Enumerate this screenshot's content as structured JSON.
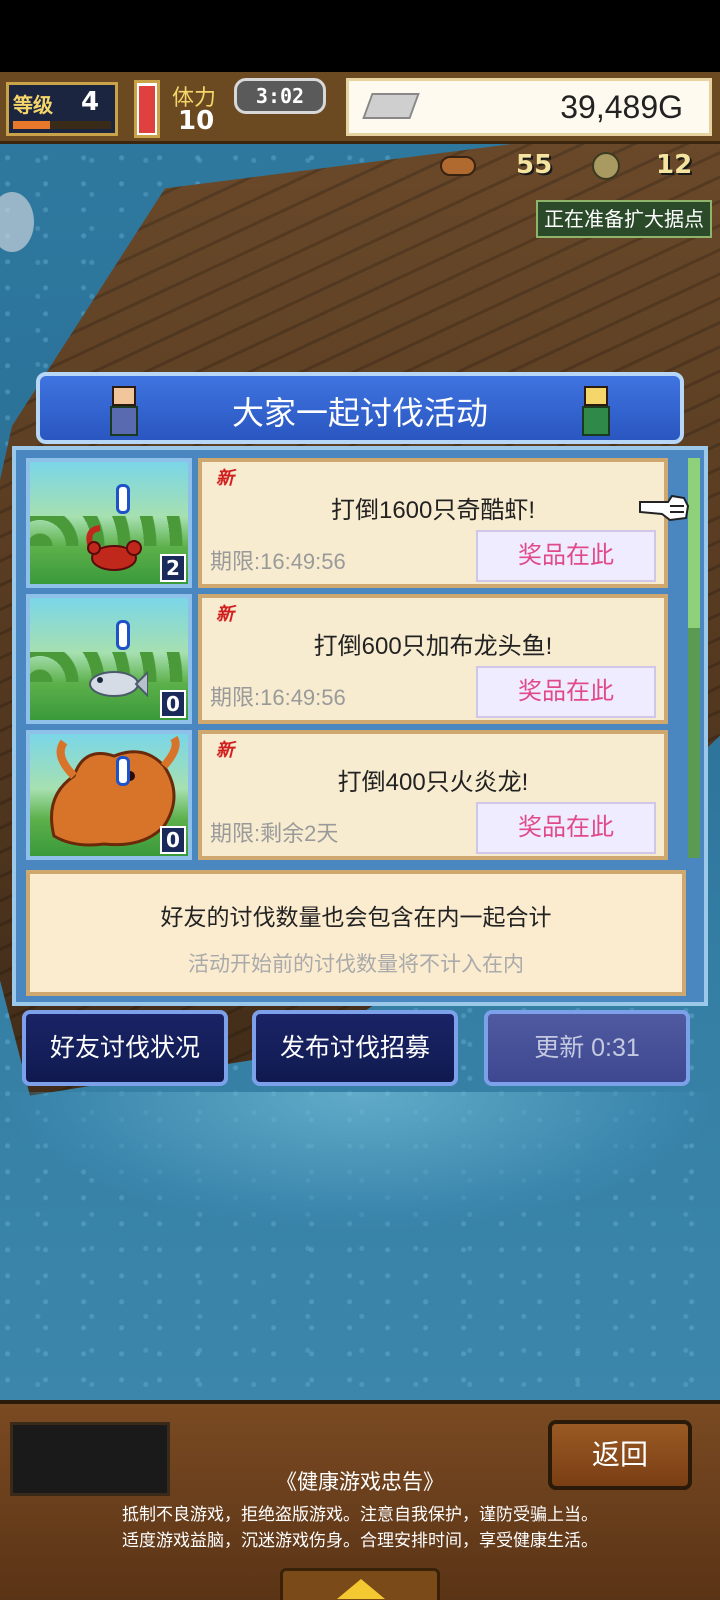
{
  "hud": {
    "level_label": "等级",
    "level_value": "4",
    "exp_fraction": 0.38,
    "stamina_fraction": 0.95,
    "people_label": "体力",
    "people_value": "10",
    "time": "3:02",
    "gold": "39,489G",
    "fish_count": "55",
    "coin_count": "12",
    "expanding_badge": "正在准备扩大据点"
  },
  "event": {
    "title": "大家一起讨伐活动",
    "quests": [
      {
        "new_tag": "新",
        "title": "打倒1600只奇酷虾!",
        "deadline": "期限:16:49:56",
        "prize_label": "奖品在此",
        "count": "2",
        "monster": "red-scorpion"
      },
      {
        "new_tag": "新",
        "title": "打倒600只加布龙头鱼!",
        "deadline": "期限:16:49:56",
        "prize_label": "奖品在此",
        "count": "0",
        "monster": "silver-fish"
      },
      {
        "new_tag": "新",
        "title": "打倒400只火炎龙!",
        "deadline": "期限:剩余2天",
        "prize_label": "奖品在此",
        "count": "0",
        "monster": "fire-dragon"
      }
    ],
    "note_main": "好友的讨伐数量也会包含在内一起合计",
    "note_sub": "活动开始前的讨伐数量将不计入在内"
  },
  "actions": {
    "friend_status": "好友讨伐状况",
    "publish_recruit": "发布讨伐招募",
    "refresh": "更新 0:31"
  },
  "bottom": {
    "return_label": "返回",
    "health_title": "《健康游戏忠告》",
    "health_line1": "抵制不良游戏，拒绝盗版游戏。注意自我保护，谨防受骗上当。",
    "health_line2": "适度游戏益脑，沉迷游戏伤身。合理安排时间，享受健康生活。"
  },
  "colors": {
    "accent_blue": "#2a56c0",
    "prize_pink": "#e04a8a",
    "new_red": "#d02020"
  }
}
